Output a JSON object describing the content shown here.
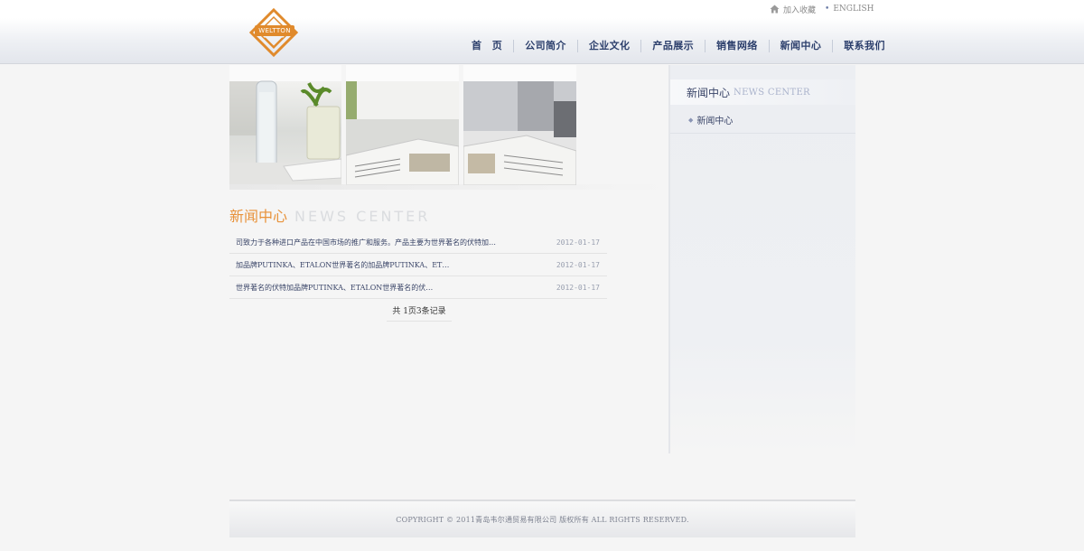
{
  "header": {
    "logo_text": "WELTTON",
    "top_links": {
      "favorite": "加入收藏",
      "english": "ENGLISH"
    },
    "nav": [
      {
        "label": "首　页"
      },
      {
        "label": "公司简介"
      },
      {
        "label": "企业文化"
      },
      {
        "label": "产品展示"
      },
      {
        "label": "销售网络"
      },
      {
        "label": "新闻中心"
      },
      {
        "label": "联系我们"
      }
    ]
  },
  "main": {
    "title_cn": "新闻中心",
    "title_en": "NEWS CENTER",
    "news": [
      {
        "title": "司致力于各种进口产品在中国市场的推广和服务。产品主要为世界著名的伏特加…",
        "date": "2012-01-17"
      },
      {
        "title": "加品牌PUTINKA、ETALON世界著名的加品牌PUTINKA、ET…",
        "date": "2012-01-17"
      },
      {
        "title": "世界著名的伏特加品牌PUTINKA、ETALON世界著名的伏…",
        "date": "2012-01-17"
      }
    ],
    "pager": "共 1页3条记录"
  },
  "sidebar": {
    "title_cn": "新闻中心",
    "title_en": "NEWS CENTER",
    "items": [
      {
        "label": "新闻中心"
      }
    ]
  },
  "footer": {
    "copyright": "COPYRIGHT © 2011青岛韦尔通贸易有限公司 版权所有 ALL RIGHTS RESERVED."
  },
  "colors": {
    "accent_orange": "#e8923a",
    "nav_blue": "#2c3f6c"
  }
}
